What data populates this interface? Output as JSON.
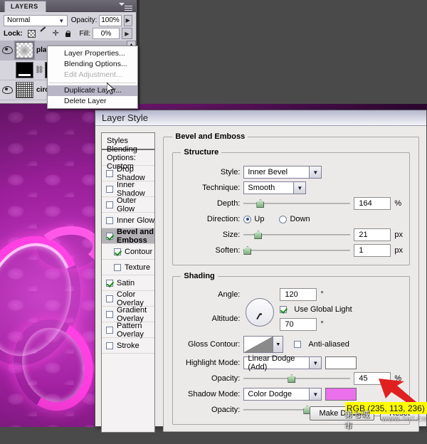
{
  "layers_panel": {
    "tab_label": "LAYERS",
    "blend_mode": "Normal",
    "opacity_label": "Opacity:",
    "opacity_value": "100%",
    "lock_label": "Lock:",
    "lock_icons": [
      "lock-transparent-pixels-icon",
      "lock-image-pixels-icon",
      "lock-position-icon",
      "lock-all-icon"
    ],
    "fill_label": "Fill:",
    "fill_value": "0%",
    "rows": [
      {
        "name": "pla",
        "visible": "eye-icon",
        "thumb": "transparent-layer-thumb",
        "selected": true
      },
      {
        "name": "",
        "visible": "",
        "thumb": "black-mask-thumb",
        "selected": false
      },
      {
        "name": "circ",
        "visible": "eye-icon",
        "thumb": "pattern-thumb",
        "selected": false
      }
    ]
  },
  "context_menu": {
    "items": [
      {
        "label": "Layer Properties...",
        "state": "normal"
      },
      {
        "label": "Blending Options...",
        "state": "normal"
      },
      {
        "label": "Edit Adjustment...",
        "state": "disabled"
      },
      {
        "label": "Duplicate Layer...",
        "state": "highlight"
      },
      {
        "label": "Delete Layer",
        "state": "normal"
      }
    ]
  },
  "dialog": {
    "title": "Layer Style",
    "styles_header": "Styles",
    "styles": [
      {
        "label": "Blending Options: Custom",
        "checkbox": false,
        "checked": false,
        "active": false,
        "sub": false
      },
      {
        "label": "Drop Shadow",
        "checkbox": true,
        "checked": false,
        "active": false,
        "sub": false
      },
      {
        "label": "Inner Shadow",
        "checkbox": true,
        "checked": false,
        "active": false,
        "sub": false
      },
      {
        "label": "Outer Glow",
        "checkbox": true,
        "checked": false,
        "active": false,
        "sub": false
      },
      {
        "label": "Inner Glow",
        "checkbox": true,
        "checked": false,
        "active": false,
        "sub": false
      },
      {
        "label": "Bevel and Emboss",
        "checkbox": true,
        "checked": true,
        "active": true,
        "sub": false
      },
      {
        "label": "Contour",
        "checkbox": true,
        "checked": true,
        "active": false,
        "sub": true
      },
      {
        "label": "Texture",
        "checkbox": true,
        "checked": false,
        "active": false,
        "sub": true
      },
      {
        "label": "Satin",
        "checkbox": true,
        "checked": true,
        "active": false,
        "sub": false
      },
      {
        "label": "Color Overlay",
        "checkbox": true,
        "checked": false,
        "active": false,
        "sub": false
      },
      {
        "label": "Gradient Overlay",
        "checkbox": true,
        "checked": false,
        "active": false,
        "sub": false
      },
      {
        "label": "Pattern Overlay",
        "checkbox": true,
        "checked": false,
        "active": false,
        "sub": false
      },
      {
        "label": "Stroke",
        "checkbox": true,
        "checked": false,
        "active": false,
        "sub": false
      }
    ],
    "bevel": {
      "legend": "Bevel and Emboss",
      "structure": {
        "legend": "Structure",
        "style_label": "Style:",
        "style_value": "Inner Bevel",
        "technique_label": "Technique:",
        "technique_value": "Smooth",
        "depth_label": "Depth:",
        "depth_value": "164",
        "depth_unit": "%",
        "direction_label": "Direction:",
        "direction_up": "Up",
        "direction_down": "Down",
        "direction_selected": "Up",
        "size_label": "Size:",
        "size_value": "21",
        "size_unit": "px",
        "soften_label": "Soften:",
        "soften_value": "1",
        "soften_unit": "px"
      },
      "shading": {
        "legend": "Shading",
        "angle_label": "Angle:",
        "angle_value": "120",
        "degree_unit": "°",
        "use_global_light": "Use Global Light",
        "use_global_light_checked": true,
        "altitude_label": "Altitude:",
        "altitude_value": "70",
        "gloss_contour_label": "Gloss Contour:",
        "anti_aliased": "Anti-aliased",
        "anti_aliased_checked": false,
        "highlight_mode_label": "Highlight Mode:",
        "highlight_mode_value": "Linear Dodge (Add)",
        "highlight_color": "#ffffff",
        "highlight_opacity_label": "Opacity:",
        "highlight_opacity_value": "45",
        "shadow_mode_label": "Shadow Mode:",
        "shadow_mode_value": "Color Dodge",
        "shadow_color": "#eb71ec",
        "shadow_opacity_label": "Opacity:",
        "shadow_opacity_value": "59",
        "percent_unit": "%"
      }
    },
    "buttons": {
      "make_default": "Make Default",
      "reset": "Reset"
    }
  },
  "tooltip": {
    "text": "RGB (235, 113, 236)",
    "background": "#ffff00"
  },
  "watermark": {
    "cn": "第七城市",
    "url": "WWW.TH7.CN"
  }
}
